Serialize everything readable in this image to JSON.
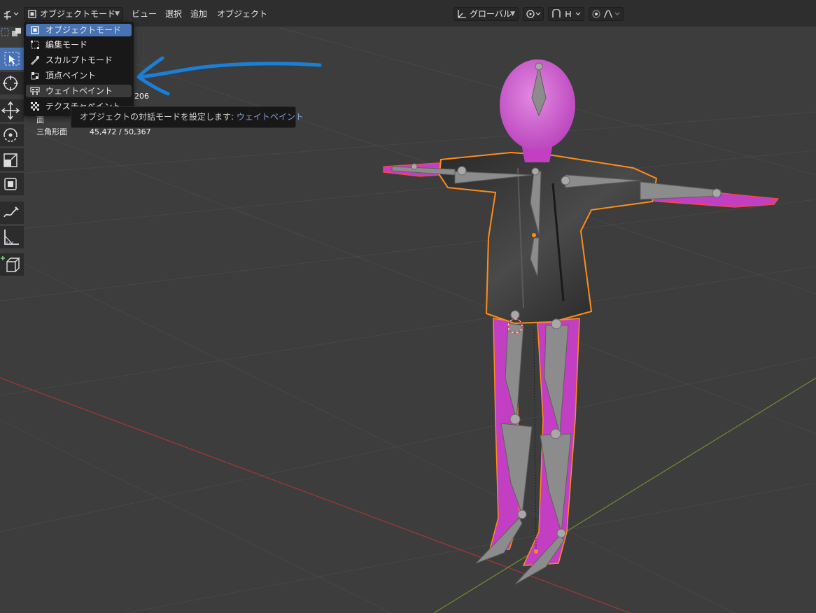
{
  "header": {
    "mode_selector": "オブジェクトモード",
    "menus": [
      "ビュー",
      "選択",
      "追加",
      "オブジェクト"
    ],
    "transform_orientation": "グローバル"
  },
  "mode_menu": {
    "items": [
      {
        "label": "オブジェクトモード",
        "icon": "object-mode-icon",
        "state": "selected"
      },
      {
        "label": "編集モード",
        "icon": "edit-mode-icon",
        "state": ""
      },
      {
        "label": "スカルプトモード",
        "icon": "sculpt-mode-icon",
        "state": ""
      },
      {
        "label": "頂点ペイント",
        "icon": "vertex-paint-icon",
        "state": ""
      },
      {
        "label": "ウェイトペイント",
        "icon": "weight-paint-icon",
        "state": "hover"
      },
      {
        "label": "テクスチャペイント",
        "icon": "texture-paint-icon",
        "state": ""
      }
    ]
  },
  "tooltip": {
    "text": "オブジェクトの対話モードを設定します:",
    "value": "ウェイトペイント"
  },
  "stats": {
    "partial_value": "206",
    "face_label": "面",
    "tri_label": "三角形面",
    "tri_value": "45,472 / 50,367"
  },
  "colors": {
    "viewport_bg": "#3d3d3d",
    "accent": "#4772b3",
    "selection_outline": "#ff8c1a",
    "weight_paint_magenta": "#cc33cc",
    "annotation_arrow": "#1a7fd9",
    "x_axis": "#b23a3a",
    "y_axis": "#6a8f2a"
  },
  "toolbar_tools": [
    "select-box-icon",
    "cursor-icon",
    "move-icon",
    "rotate-icon",
    "scale-icon",
    "transform-icon",
    "annotate-icon",
    "measure-icon",
    "add-cube-icon"
  ]
}
